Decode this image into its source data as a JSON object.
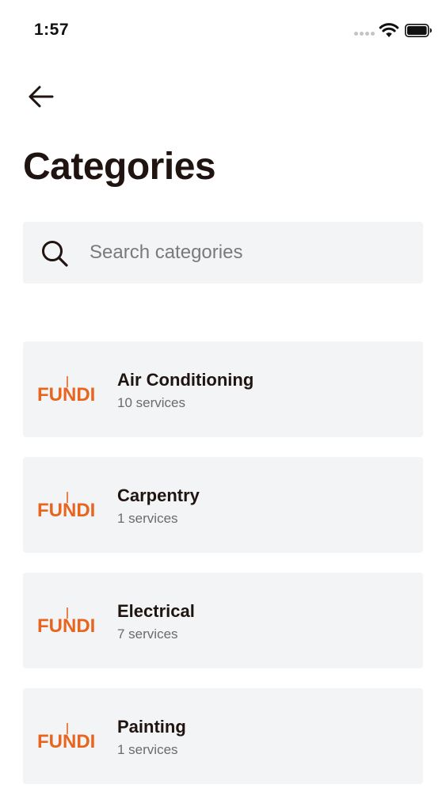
{
  "status_bar": {
    "time": "1:57"
  },
  "header": {
    "back_icon": "arrow-left-icon",
    "title": "Categories"
  },
  "search": {
    "placeholder": "Search categories",
    "value": "",
    "icon": "search-icon"
  },
  "categories": [
    {
      "name": "Air Conditioning",
      "count": "10 services",
      "logo_text": "FUNDI"
    },
    {
      "name": "Carpentry",
      "count": "1 services",
      "logo_text": "FUNDI"
    },
    {
      "name": "Electrical",
      "count": "7 services",
      "logo_text": "FUNDI"
    },
    {
      "name": "Painting",
      "count": "1 services",
      "logo_text": "FUNDI"
    }
  ],
  "colors": {
    "brand": "#e8651f",
    "card_bg": "#f3f4f6",
    "text_primary": "#1f1410",
    "text_secondary": "#6b6b6b"
  }
}
